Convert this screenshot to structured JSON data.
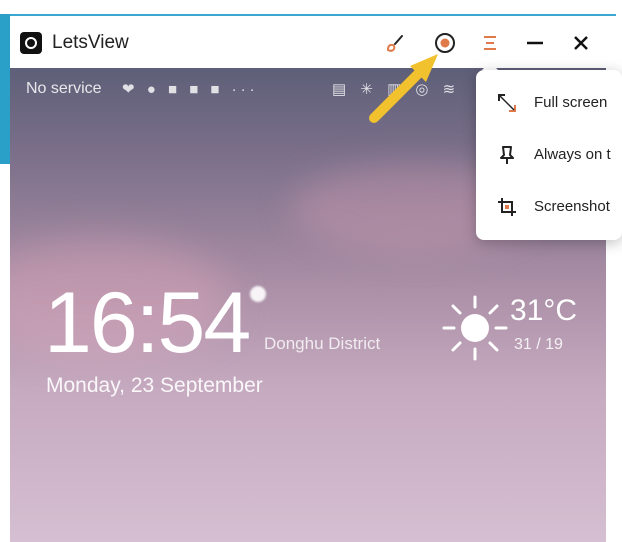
{
  "window": {
    "title": "LetsView"
  },
  "toolbar": {
    "brush": "brush-icon",
    "record": "record-icon",
    "menu": "menu-icon",
    "minimize": "minimize-icon",
    "close": "close-icon"
  },
  "phone": {
    "status_text": "No service",
    "status_icons": "❤ ● ■ ■ ■ ···",
    "status_right": "▤ ✳ ▥ ◎ ≋",
    "clock": "16:54",
    "location": "Donghu District",
    "date": "Monday, 23 September",
    "temp": "31°C",
    "temp_range": "31 / 19"
  },
  "menu": {
    "items": [
      {
        "label": "Full screen",
        "icon": "fullscreen-icon"
      },
      {
        "label": "Always on t",
        "icon": "pin-icon"
      },
      {
        "label": "Screenshot",
        "icon": "crop-icon"
      }
    ]
  },
  "colors": {
    "accent": "#e07a4a",
    "titlebar_border": "#3aa7d2",
    "arrow": "#f2c12e"
  }
}
